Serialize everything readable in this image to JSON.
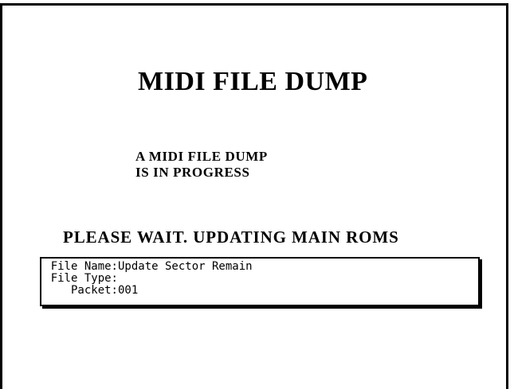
{
  "screen": {
    "title": "MIDI FILE DUMP",
    "status_lines": [
      "A MIDI FILE DUMP",
      "IS IN PROGRESS"
    ],
    "wait_message": "PLEASE WAIT.  UPDATING MAIN ROMS"
  },
  "info": {
    "file_name_label": "File Name:",
    "file_name_value": "Update Sector Remain",
    "file_type_label": "File Type:",
    "file_type_value": "",
    "packet_label": "Packet:",
    "packet_value": "001"
  }
}
